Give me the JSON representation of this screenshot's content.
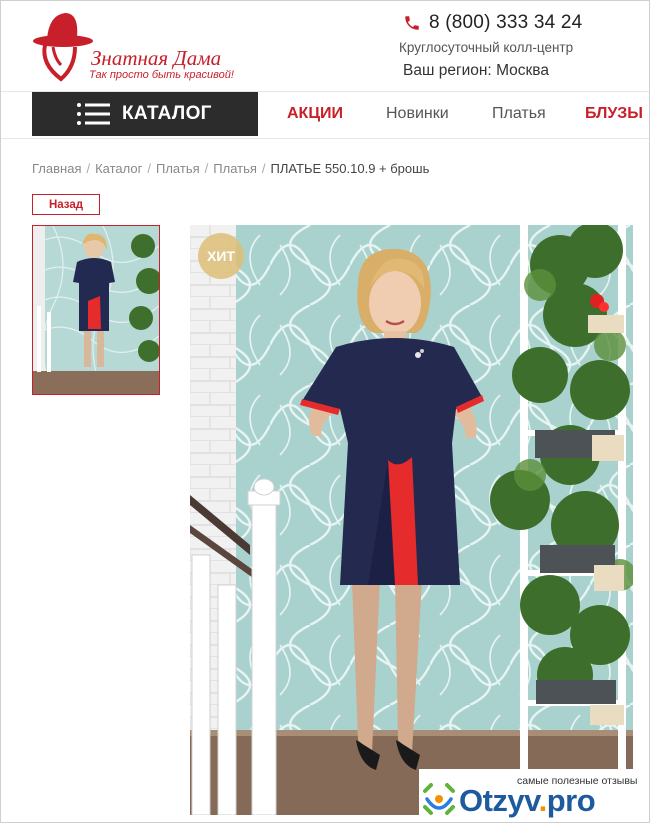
{
  "brand": {
    "name": "Знатная Дама",
    "slogan": "Так просто быть красивой!"
  },
  "contacts": {
    "phone": "8 (800) 333 34 24",
    "callcenter": "Круглосуточный колл-центр",
    "region_label": "Ваш регион:",
    "region_value": "Москва"
  },
  "nav": {
    "catalog": "КАТАЛОГ",
    "items": [
      "АКЦИИ",
      "Новинки",
      "Платья",
      "БЛУЗЫ"
    ]
  },
  "breadcrumb": [
    "Главная",
    "Каталог",
    "Платья",
    "Платья",
    "ПЛАТЬЕ 550.10.9 + брошь"
  ],
  "back_button": "Назад",
  "product": {
    "badge": "ХИТ"
  },
  "watermark": {
    "tagline": "самые полезные отзывы",
    "brand_main": "Otzyv",
    "brand_dot": ".",
    "brand_tld": "pro"
  },
  "colors": {
    "accent": "#c8202a",
    "dark": "#2c2c2c"
  }
}
